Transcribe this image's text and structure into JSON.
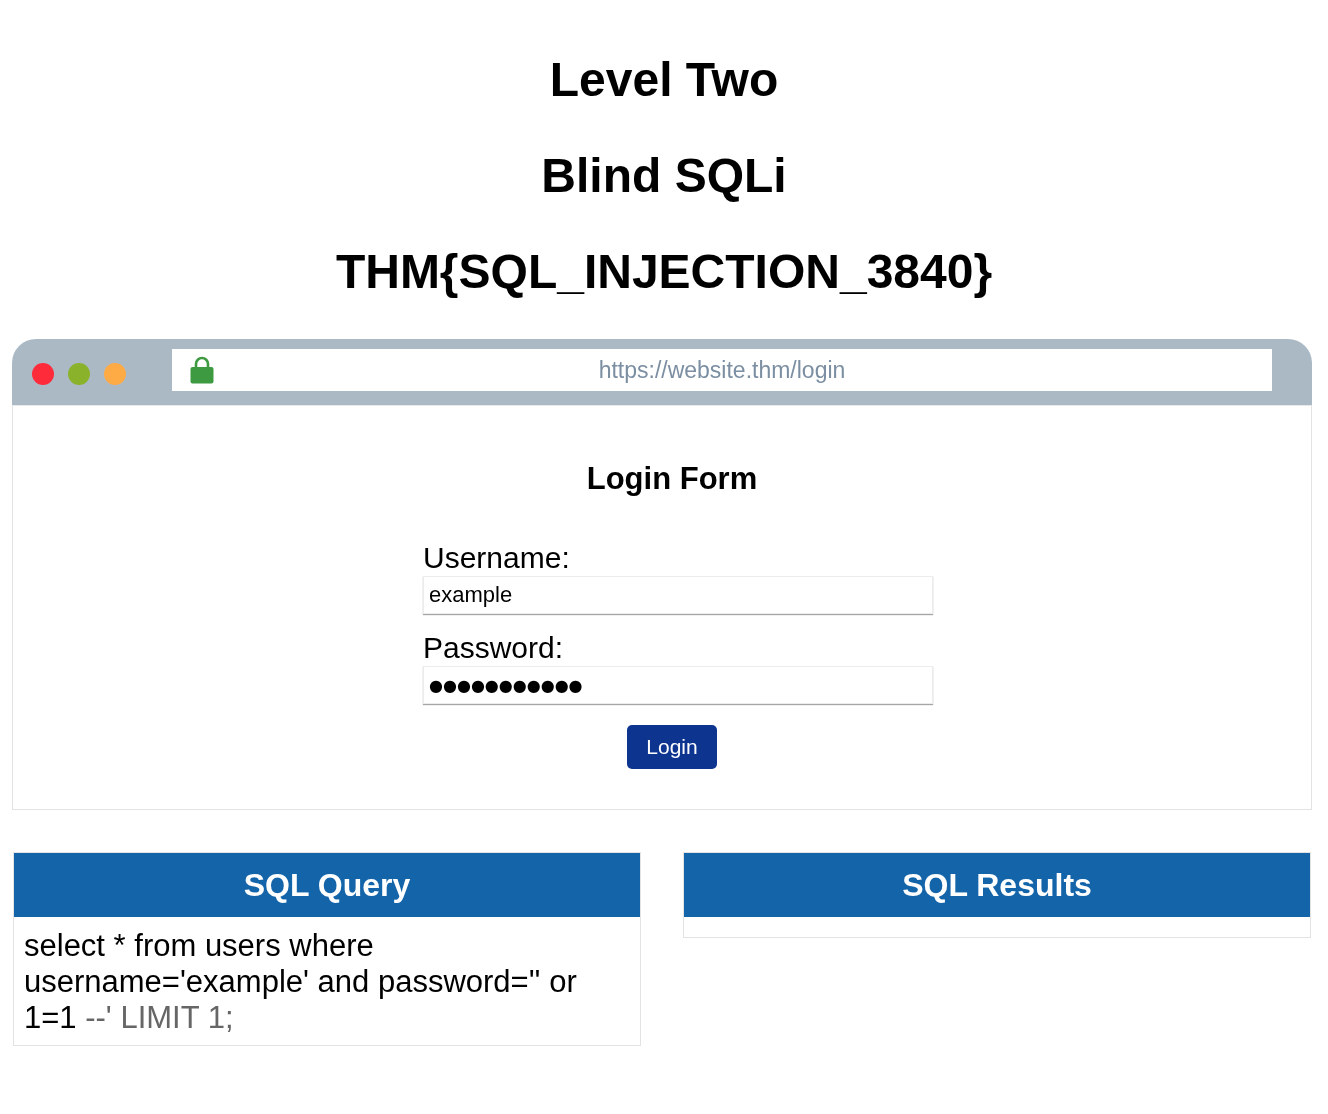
{
  "headings": [
    "Level Two",
    "Blind SQLi",
    "THM{SQL_INJECTION_3840}"
  ],
  "browser": {
    "url": "https://website.thm/login"
  },
  "login_form": {
    "title": "Login Form",
    "fields": [
      {
        "label": "Username:",
        "value": "example",
        "kind": "text"
      },
      {
        "label": "Password:",
        "value": "●●●●●●●●●●●",
        "kind": "masked"
      }
    ],
    "button": "Login"
  },
  "panels": [
    {
      "title": "SQL Query",
      "query": [
        {
          "text": "select * from users where username='example' and password='' or 1=1",
          "commented": false
        },
        {
          "text": "--' LIMIT 1;",
          "commented": true
        }
      ]
    },
    {
      "title": "SQL Results"
    }
  ]
}
